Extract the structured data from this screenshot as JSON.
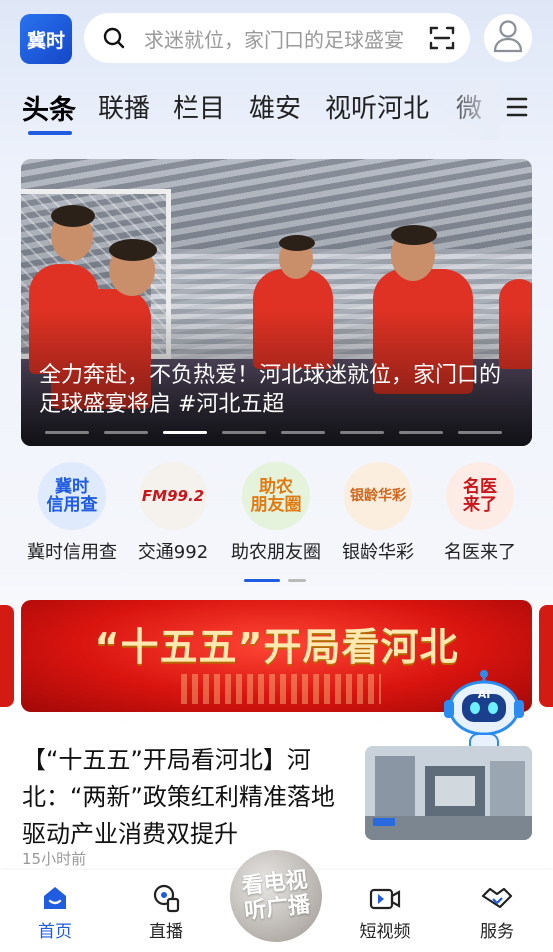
{
  "header": {
    "logo_text": "冀时",
    "search_placeholder": "求迷就位，家门口的足球盛宴",
    "icons": [
      "search-icon",
      "scan-icon",
      "user-icon"
    ]
  },
  "tabs": [
    {
      "label": "头条",
      "active": true
    },
    {
      "label": "联播"
    },
    {
      "label": "栏目"
    },
    {
      "label": "雄安"
    },
    {
      "label": "视听河北"
    },
    {
      "label": "微"
    }
  ],
  "carousel": {
    "caption": "全力奔赴，不负热爱！河北球迷就位，家门口的足球盛宴将启 #河北五超",
    "slide_count": 8,
    "active_index": 2
  },
  "shortcuts": [
    {
      "label": "冀时信用查",
      "icon_text": "冀时\n信用查",
      "color": "#1f5ce0",
      "bg": "#dfeafc"
    },
    {
      "label": "交通992",
      "icon_text": "FM99.2",
      "color": "#c8161d",
      "bg": "#f5f1ec"
    },
    {
      "label": "助农朋友圈",
      "icon_text": "助农\n朋友圈",
      "color": "#e07a12",
      "bg": "#e6f3dc"
    },
    {
      "label": "银龄华彩",
      "icon_text": "银龄华彩",
      "color": "#d0651b",
      "bg": "#fbeede"
    },
    {
      "label": "名医来了",
      "icon_text": "名医\n来了",
      "color": "#c9161b",
      "bg": "#fdece5"
    }
  ],
  "shortcut_pages": {
    "count": 2,
    "active": 0
  },
  "banner": {
    "text": "“十五五”开局看河北"
  },
  "news": [
    {
      "title": "【“十五五”开局看河北】河北：“两新”政策红利精准落地 驱动产业消费双提升",
      "time": "15小时前"
    }
  ],
  "bottom_nav": [
    {
      "label": "首页",
      "icon": "home-icon",
      "active": true
    },
    {
      "label": "直播",
      "icon": "live-icon"
    },
    {
      "label": "看电视听广播",
      "icon": "tv-radio-icon",
      "center": true
    },
    {
      "label": "短视频",
      "icon": "short-video-icon"
    },
    {
      "label": "服务",
      "icon": "service-icon"
    }
  ],
  "center_button": {
    "line1": "看电视",
    "line2": "听广播"
  },
  "colors": {
    "accent": "#1f5ce0",
    "banner_red": "#d9140f"
  }
}
